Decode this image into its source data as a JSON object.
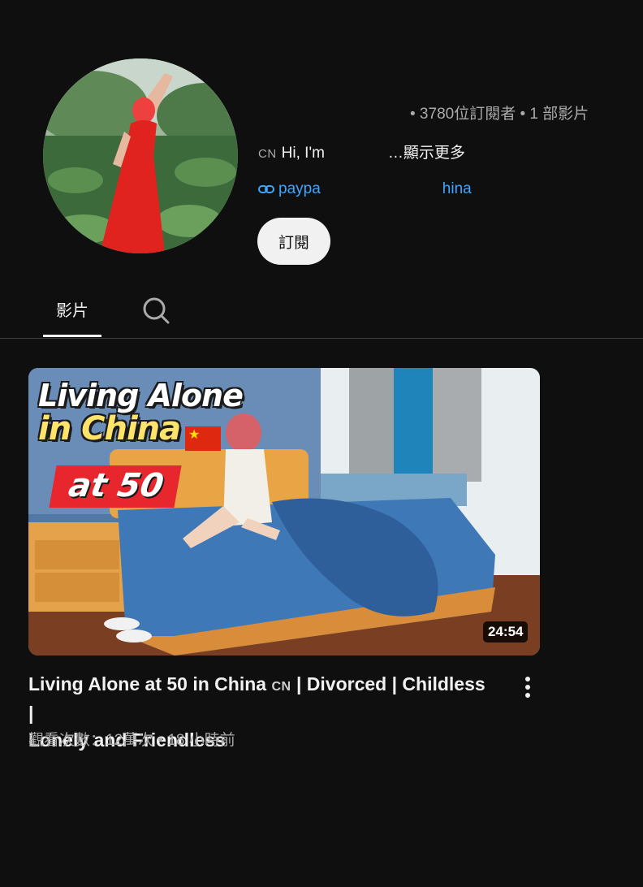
{
  "channel": {
    "subscriber_meta": "• 3780位訂閱者 • 1 部影片",
    "about_flag": "CN",
    "about_prefix": "Hi, I'm",
    "about_suffix": "…",
    "show_more": "顯示更多",
    "link_start": "paypa",
    "link_end": "hina",
    "subscribe_label": "訂閱"
  },
  "tabs": {
    "videos_label": "影片"
  },
  "video": {
    "thumb_line1": "Living Alone",
    "thumb_line2": "in China",
    "thumb_badge": "at 50",
    "duration": "24:54",
    "title_part1": "Living Alone at 50 in China",
    "title_flag": "CN",
    "title_part2": "| Divorced | Childless |",
    "title_part3": "Lonely and Friendless",
    "meta": "觀看次數：12萬次 • 18 小時前"
  },
  "colors": {
    "background": "#0f0f0f",
    "text_primary": "#f1f1f1",
    "text_secondary": "#aaaaaa",
    "link": "#3ea6ff",
    "badge_red": "#e8262d"
  },
  "icons": [
    "link-icon",
    "search-icon",
    "more-vert-icon",
    "cn-flag-icon"
  ]
}
